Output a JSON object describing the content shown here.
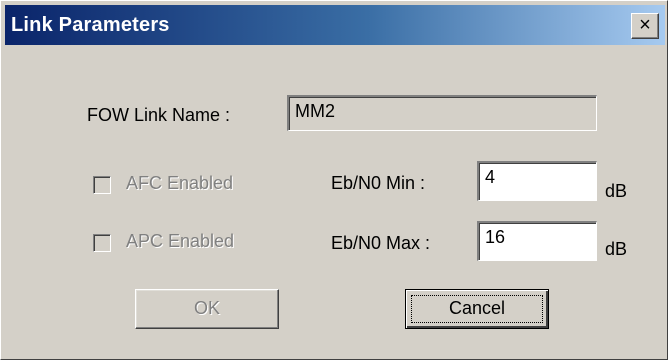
{
  "dialog": {
    "title": "Link Parameters",
    "close_glyph": "×"
  },
  "form": {
    "link_name_label": "FOW Link Name :",
    "link_name_value": "MM2",
    "afc_label": "AFC Enabled",
    "apc_label": "APC Enabled",
    "ebn0_min_label": "Eb/N0 Min :",
    "ebn0_min_value": "4",
    "ebn0_max_label": "Eb/N0 Max :",
    "ebn0_max_value": "16",
    "unit_db": "dB"
  },
  "buttons": {
    "ok_label": "OK",
    "cancel_label": "Cancel"
  }
}
